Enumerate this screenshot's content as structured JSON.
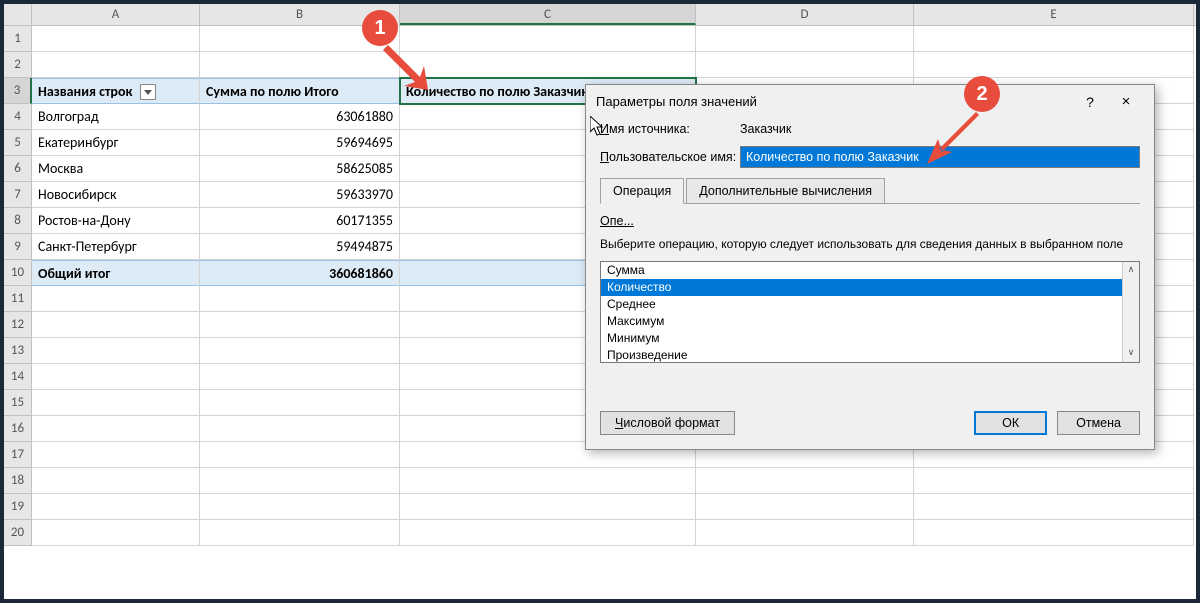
{
  "columns": [
    "A",
    "B",
    "C",
    "D",
    "E"
  ],
  "row_numbers": [
    1,
    2,
    3,
    4,
    5,
    6,
    7,
    8,
    9,
    10,
    11,
    12,
    13,
    14,
    15,
    16,
    17,
    18,
    19,
    20
  ],
  "selected_cell": "C3",
  "pivot": {
    "headers": {
      "row_label": "Названия строк",
      "sum_field": "Сумма по полю Итого",
      "count_field": "Количество по полю Заказчик"
    },
    "rows": [
      {
        "name": "Волгоград",
        "sum": "63061880"
      },
      {
        "name": "Екатеринбург",
        "sum": "59694695"
      },
      {
        "name": "Москва",
        "sum": "58625085"
      },
      {
        "name": "Новосибирск",
        "sum": "59633970"
      },
      {
        "name": "Ростов-на-Дону",
        "sum": "60171355"
      },
      {
        "name": "Санкт-Петербург",
        "sum": "59494875"
      }
    ],
    "total": {
      "label": "Общий итог",
      "sum": "360681860"
    }
  },
  "dialog": {
    "title": "Параметры поля значений",
    "help": "?",
    "close": "×",
    "source_label": "Имя источника:",
    "source_value": "Заказчик",
    "custom_name_label": "Пользовательское имя:",
    "custom_name_value": "Количество по полю Заказчик",
    "tabs": {
      "operation": "Операция",
      "additional": "Дополнительные вычисления"
    },
    "op_short": "Опе...",
    "op_desc": "Выберите операцию, которую следует использовать для сведения данных в выбранном поле",
    "operations": [
      "Сумма",
      "Количество",
      "Среднее",
      "Максимум",
      "Минимум",
      "Произведение"
    ],
    "selected_operation": "Количество",
    "number_format": "Числовой формат",
    "ok": "ОК",
    "cancel": "Отмена"
  },
  "callouts": {
    "c1": "1",
    "c2": "2"
  }
}
